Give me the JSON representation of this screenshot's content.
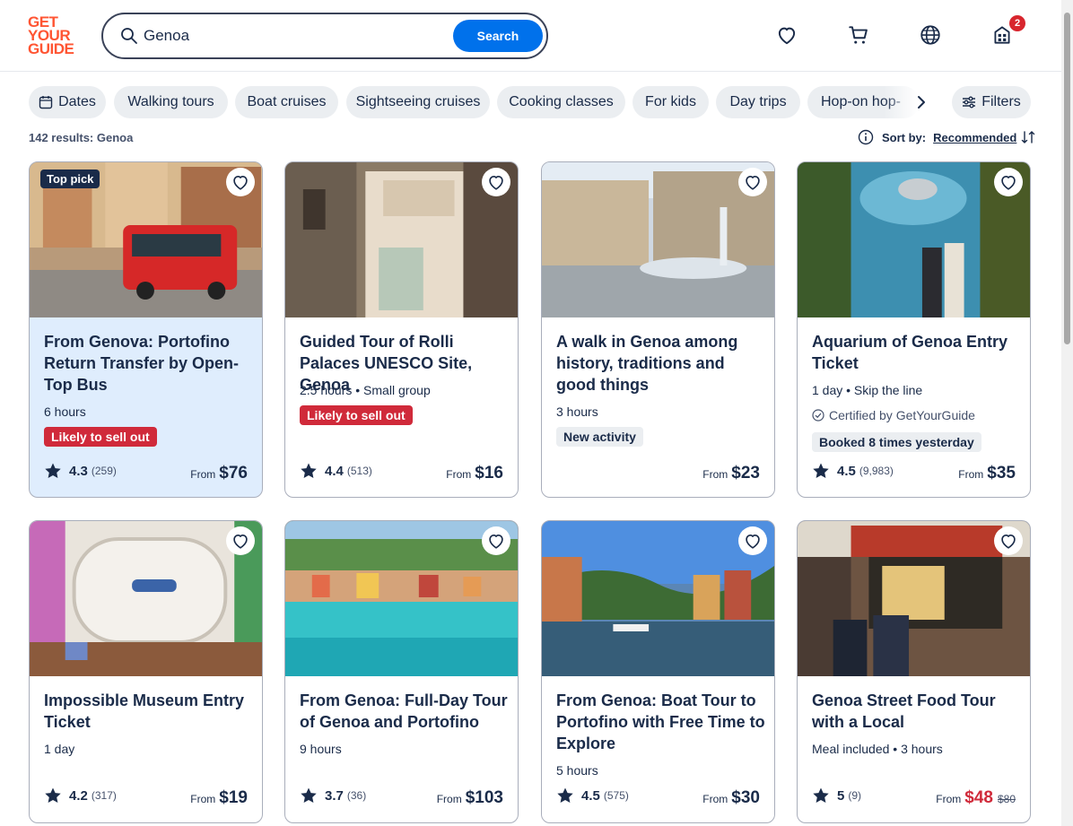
{
  "header": {
    "logo_lines": [
      "GET",
      "YOUR",
      "GUIDE"
    ],
    "search_value": "Genoa",
    "search_button": "Search",
    "cart_badge": "2"
  },
  "filters": {
    "chips": [
      "Dates",
      "Walking tours",
      "Boat cruises",
      "Sightseeing cruises",
      "Cooking classes",
      "For kids",
      "Day trips",
      "Hop-on hop-"
    ],
    "filters_label": "Filters"
  },
  "results": {
    "count_text": "142 results: Genoa",
    "sort_label": "Sort by:",
    "sort_value": "Recommended"
  },
  "colors": {
    "brand": "#ff5533",
    "accent": "#0071eb",
    "alert": "#d02a3a"
  },
  "cards": [
    {
      "title": "From Genova: Portofino Return Transfer by Open-Top Bus",
      "meta": "6 hours",
      "badge_top": "Top pick",
      "tag_red": "Likely to sell out",
      "score": "4.3",
      "count": "(259)",
      "from": "From",
      "price": "$76"
    },
    {
      "title": "Guided Tour of Rolli Palaces UNESCO Site, Genoa",
      "meta": "2.5 hours • Small group",
      "tag_red": "Likely to sell out",
      "score": "4.4",
      "count": "(513)",
      "from": "From",
      "price": "$16"
    },
    {
      "title": "A walk in Genoa among history, traditions and good things",
      "meta": "3 hours",
      "tag_grey": "New activity",
      "from": "From",
      "price": "$23"
    },
    {
      "title": "Aquarium of Genoa Entry Ticket",
      "meta": "1 day • Skip the line",
      "certified": "Certified by GetYourGuide",
      "tag_grey": "Booked 8 times yesterday",
      "score": "4.5",
      "count": "(9,983)",
      "from": "From",
      "price": "$35"
    },
    {
      "title": "Impossible Museum Entry Ticket",
      "meta": "1 day",
      "score": "4.2",
      "count": "(317)",
      "from": "From",
      "price": "$19"
    },
    {
      "title": "From Genoa: Full-Day Tour of Genoa and Portofino",
      "meta": "9 hours",
      "score": "3.7",
      "count": "(36)",
      "from": "From",
      "price": "$103"
    },
    {
      "title": "From Genoa: Boat Tour to Portofino with Free Time to Explore",
      "meta": "5 hours",
      "score": "4.5",
      "count": "(575)",
      "from": "From",
      "price": "$30"
    },
    {
      "title": "Genoa Street Food Tour with a Local",
      "meta": "Meal included • 3 hours",
      "score": "5",
      "count": "(9)",
      "from": "From",
      "price": "$48",
      "old_price": "$80"
    }
  ]
}
